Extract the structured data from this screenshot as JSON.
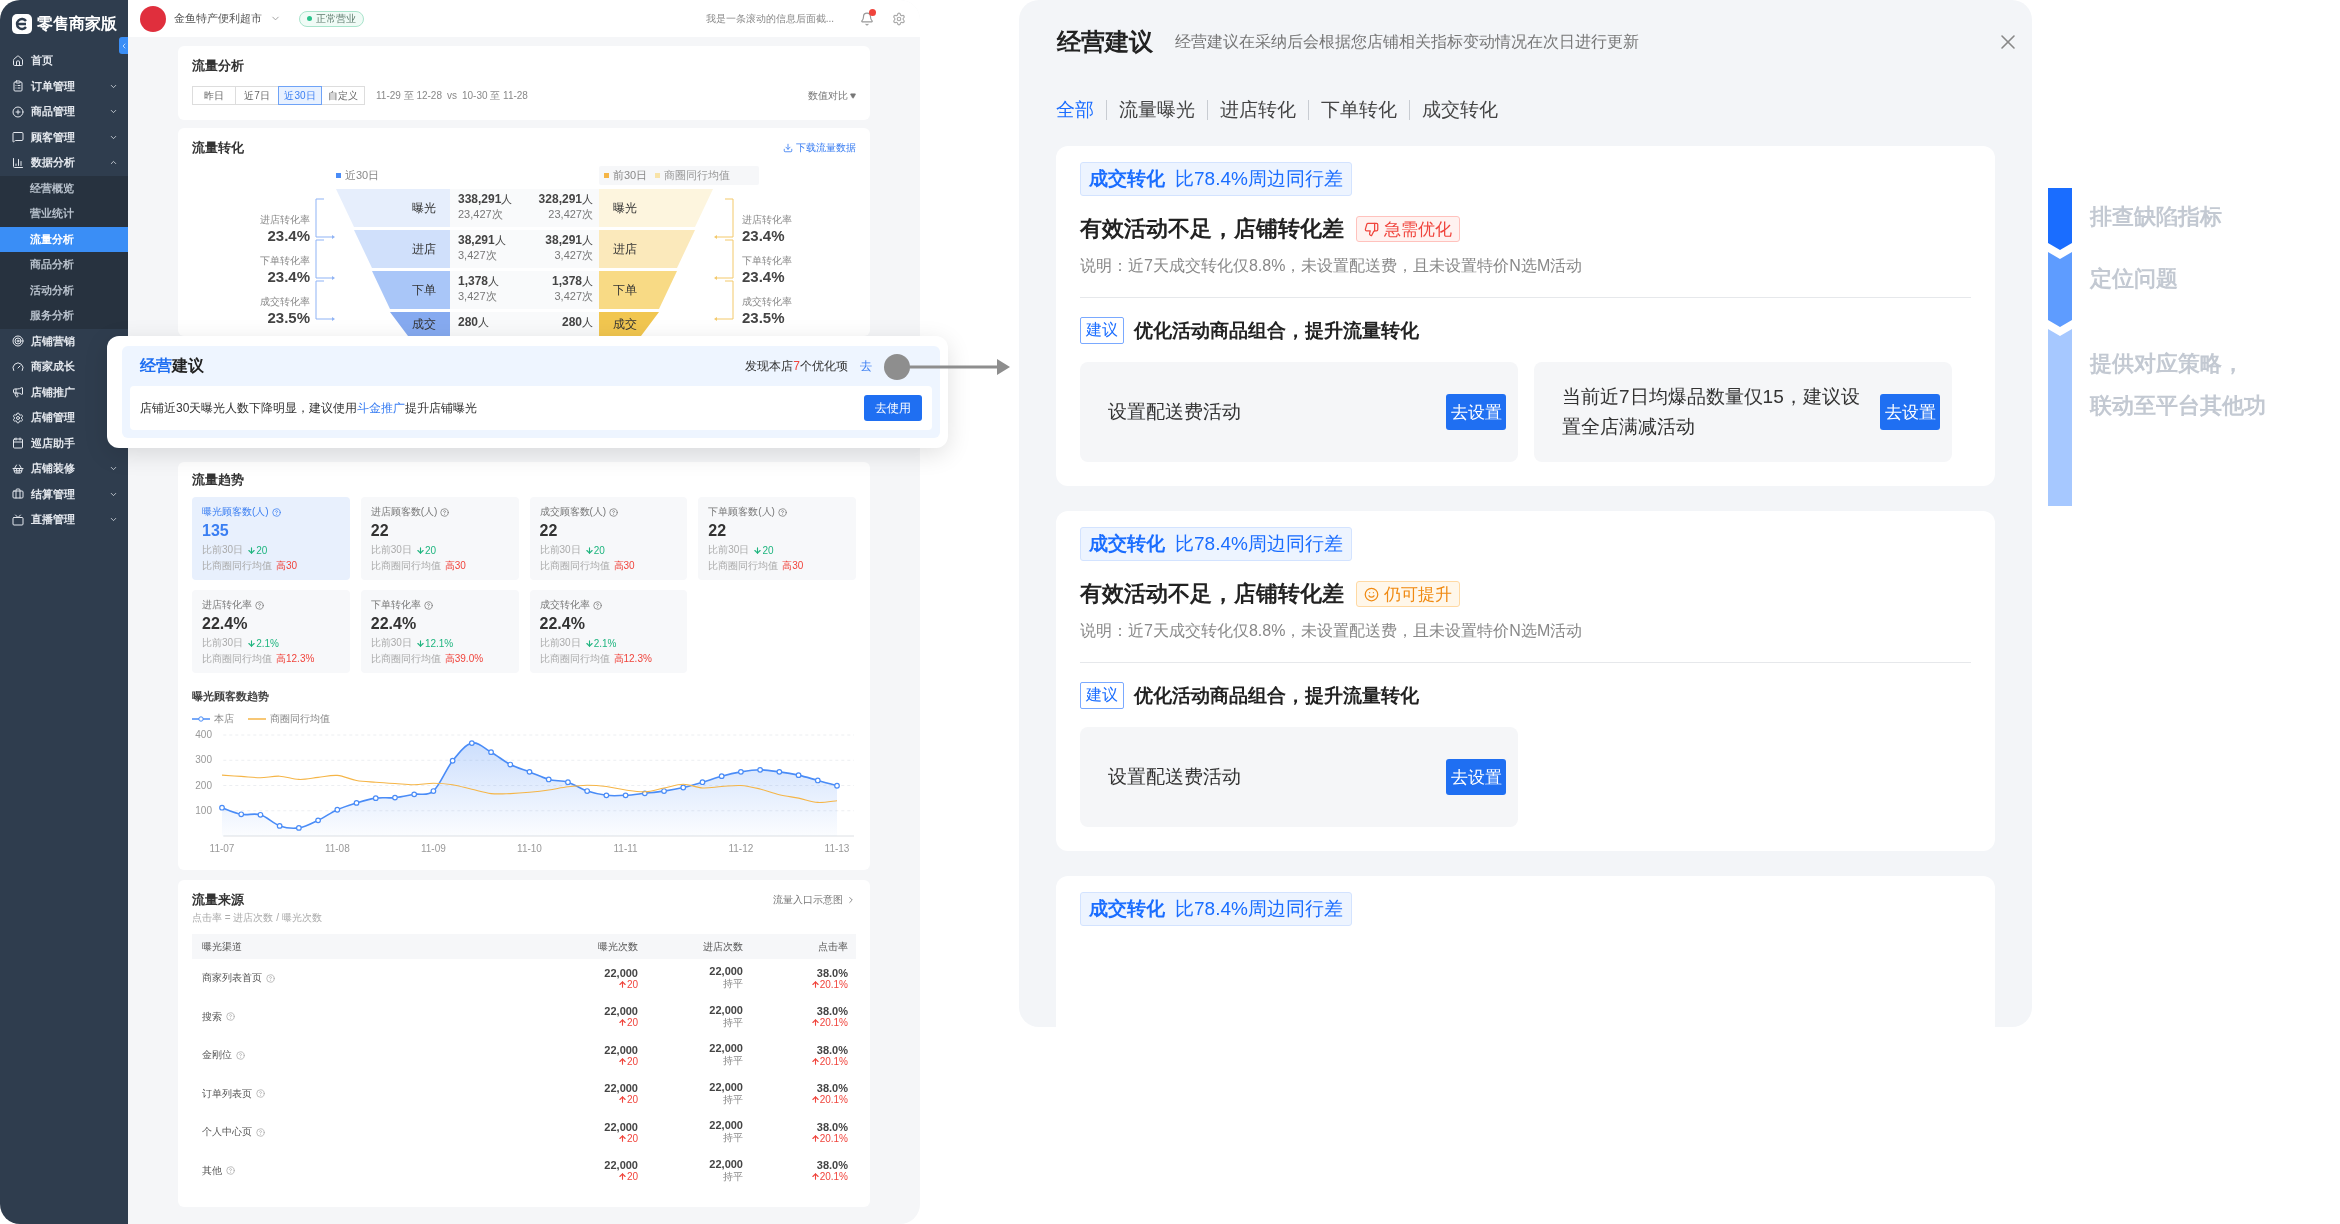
{
  "dashboard": {
    "sidebar": {
      "logo": "零售商家版",
      "items": [
        {
          "label": "首页",
          "kind": "link",
          "selected": false
        },
        {
          "label": "订单管理",
          "kind": "group",
          "expanded": false,
          "selected": false
        },
        {
          "label": "商品管理",
          "kind": "group",
          "expanded": false,
          "selected": false
        },
        {
          "label": "顾客管理",
          "kind": "group",
          "expanded": false,
          "selected": false
        },
        {
          "label": "数据分析",
          "kind": "group",
          "expanded": true,
          "selected": false,
          "children": [
            {
              "label": "经营概览",
              "selected": false
            },
            {
              "label": "营业统计",
              "selected": false
            },
            {
              "label": "流量分析",
              "selected": true
            },
            {
              "label": "商品分析",
              "selected": false
            },
            {
              "label": "活动分析",
              "selected": false
            },
            {
              "label": "服务分析",
              "selected": false
            }
          ]
        },
        {
          "label": "店铺营销",
          "kind": "link",
          "selected": false
        },
        {
          "label": "商家成长",
          "kind": "link",
          "selected": false
        },
        {
          "label": "店铺推广",
          "kind": "link",
          "selected": false
        },
        {
          "label": "店铺管理",
          "kind": "link",
          "selected": false
        },
        {
          "label": "巡店助手",
          "kind": "link",
          "selected": false
        },
        {
          "label": "店铺装修",
          "kind": "group",
          "expanded": false,
          "selected": false
        },
        {
          "label": "结算管理",
          "kind": "group",
          "expanded": false,
          "selected": false
        },
        {
          "label": "直播管理",
          "kind": "group",
          "expanded": false,
          "selected": false
        }
      ]
    },
    "header": {
      "store_name": "金鱼特产便利超市",
      "status": "正常营业",
      "ticker": "我是一条滚动的信息后面截..."
    },
    "traffic_analysis": {
      "title": "流量分析",
      "ranges": [
        {
          "label": "昨日",
          "selected": false
        },
        {
          "label": "近7日",
          "selected": false
        },
        {
          "label": "近30日",
          "selected": true
        },
        {
          "label": "自定义",
          "selected": false
        }
      ],
      "date_range": "11-29 至 12-28",
      "vs": "vs",
      "compare_range": "10-30 至 11-28",
      "compare_menu": "数值对比"
    },
    "conversion": {
      "title": "流量转化",
      "download": "下载流量数据",
      "current_legend": "近30日",
      "previous_legend": "前30日",
      "peer_legend": "商圈同行均值",
      "stages": [
        {
          "name": "曝光",
          "people": "338,291",
          "unit": "人",
          "visits": "23,427次",
          "prev_people": "328,291",
          "prev_unit": "人",
          "prev_visits": "23,427次",
          "prev_name": "曝光"
        },
        {
          "name": "进店",
          "people": "38,291",
          "unit": "人",
          "visits": "3,427次",
          "prev_people": "38,291",
          "prev_unit": "人",
          "prev_visits": "3,427次",
          "prev_name": "进店"
        },
        {
          "name": "下单",
          "people": "1,378",
          "unit": "人",
          "visits": "3,427次",
          "prev_people": "1,378",
          "prev_unit": "人",
          "prev_visits": "3,427次",
          "prev_name": "下单"
        },
        {
          "name": "成交",
          "people": "280",
          "unit": "人",
          "prev_people": "280",
          "prev_unit": "人",
          "prev_name": "成交"
        }
      ],
      "rates_current": [
        {
          "label": "进店转化率",
          "value": "23.4%"
        },
        {
          "label": "下单转化率",
          "value": "23.4%"
        },
        {
          "label": "成交转化率",
          "value": "23.5%"
        }
      ],
      "rates_previous": [
        {
          "label": "进店转化率",
          "value": "23.4%"
        },
        {
          "label": "下单转化率",
          "value": "23.4%"
        },
        {
          "label": "成交转化率",
          "value": "23.5%"
        }
      ]
    },
    "trend": {
      "title": "流量趋势",
      "metrics": [
        {
          "label": "曝光顾客数(人)",
          "value": "135",
          "prev_label": "比前30日",
          "prev_rising": false,
          "prev_change": "20",
          "peer_label": "比商圈同行均值",
          "peer_change": "高30",
          "selected": true
        },
        {
          "label": "进店顾客数(人)",
          "value": "22",
          "prev_label": "比前30日",
          "prev_rising": false,
          "prev_change": "20",
          "peer_label": "比商圈同行均值",
          "peer_change": "高30",
          "selected": false
        },
        {
          "label": "成交顾客数(人)",
          "value": "22",
          "prev_label": "比前30日",
          "prev_rising": false,
          "prev_change": "20",
          "peer_label": "比商圈同行均值",
          "peer_change": "高30",
          "selected": false
        },
        {
          "label": "下单顾客数(人)",
          "value": "22",
          "prev_label": "比前30日",
          "prev_rising": false,
          "prev_change": "20",
          "peer_label": "比商圈同行均值",
          "peer_change": "高30",
          "selected": false
        },
        {
          "label": "进店转化率",
          "value": "22.4%",
          "prev_label": "比前30日",
          "prev_rising": false,
          "prev_change": "2.1%",
          "peer_label": "比商圈同行均值",
          "peer_change": "高12.3%",
          "selected": false
        },
        {
          "label": "下单转化率",
          "value": "22.4%",
          "prev_label": "比前30日",
          "prev_rising": false,
          "prev_change": "12.1%",
          "peer_label": "比商圈同行均值",
          "peer_change": "高39.0%",
          "selected": false
        },
        {
          "label": "成交转化率",
          "value": "22.4%",
          "prev_label": "比前30日",
          "prev_rising": false,
          "prev_change": "2.1%",
          "peer_label": "比商圈同行均值",
          "peer_change": "高12.3%",
          "selected": false
        }
      ],
      "chart_data": {
        "type": "line",
        "title": "曝光顾客数趋势",
        "categories": [
          "11-07",
          null,
          null,
          null,
          null,
          null,
          "11-08",
          null,
          null,
          null,
          null,
          "11-09",
          null,
          null,
          null,
          null,
          "11-10",
          null,
          null,
          null,
          null,
          "11-11",
          null,
          null,
          null,
          null,
          null,
          "11-12",
          null,
          null,
          null,
          null,
          "11-13"
        ],
        "series": [
          {
            "name": "本店",
            "color": "#4a8cf7",
            "marker": "circle",
            "type": "area",
            "values": [
              112,
              86,
              84,
              40,
              32,
              62,
              104,
              131,
              150,
              152,
              165,
              178,
              298,
              368,
              332,
              283,
              254,
              224,
              213,
              178,
              161,
              161,
              169,
              178,
              192,
              213,
              237,
              254,
              262,
              254,
              241,
              220,
              199
            ]
          },
          {
            "name": "商圈同行均值",
            "color": "#f5b547",
            "type": "line",
            "values": [
              241,
              236,
              231,
              237,
              224,
              232,
              240,
              220,
              213,
              208,
              203,
              209,
              203,
              185,
              168,
              168,
              173,
              182,
              195,
              201,
              196,
              182,
              175,
              190,
              205,
              190,
              196,
              200,
              186,
              163,
              150,
              133,
              140
            ]
          }
        ],
        "ylim": [
          0,
          400
        ],
        "grid": true,
        "yticks": [
          100,
          200,
          300,
          400
        ]
      }
    },
    "sources": {
      "title": "流量来源",
      "formula": "点击率 = 进店次数 / 曝光次数",
      "diagram_link": "流量入口示意图",
      "columns": [
        "曝光渠道",
        "曝光次数",
        "进店次数",
        "点击率"
      ],
      "rows": [
        {
          "channel": "商家列表首页",
          "exposures": "22,000",
          "exposure_rising": true,
          "exposure_change": "20",
          "visits": "22,000",
          "visits_change": "持平",
          "ctr": "38.0%",
          "ctr_rising": true,
          "ctr_change": "20.1%"
        },
        {
          "channel": "搜索",
          "exposures": "22,000",
          "exposure_rising": true,
          "exposure_change": "20",
          "visits": "22,000",
          "visits_change": "持平",
          "ctr": "38.0%",
          "ctr_rising": true,
          "ctr_change": "20.1%"
        },
        {
          "channel": "金刚位",
          "exposures": "22,000",
          "exposure_rising": true,
          "exposure_change": "20",
          "visits": "22,000",
          "visits_change": "持平",
          "ctr": "38.0%",
          "ctr_rising": true,
          "ctr_change": "20.1%"
        },
        {
          "channel": "订单列表页",
          "exposures": "22,000",
          "exposure_rising": true,
          "exposure_change": "20",
          "visits": "22,000",
          "visits_change": "持平",
          "ctr": "38.0%",
          "ctr_rising": true,
          "ctr_change": "20.1%"
        },
        {
          "channel": "个人中心页",
          "exposures": "22,000",
          "exposure_rising": true,
          "exposure_change": "20",
          "visits": "22,000",
          "visits_change": "持平",
          "ctr": "38.0%",
          "ctr_rising": true,
          "ctr_change": "20.1%"
        },
        {
          "channel": "其他",
          "exposures": "22,000",
          "exposure_rising": true,
          "exposure_change": "20",
          "visits": "22,000",
          "visits_change": "持平",
          "ctr": "38.0%",
          "ctr_rising": true,
          "ctr_change": "20.1%"
        }
      ]
    }
  },
  "advice_popup": {
    "title_parts": [
      {
        "text": "经营",
        "accent": true
      },
      {
        "text": "建议",
        "accent": false
      }
    ],
    "summary_parts": [
      {
        "text": "发现本店",
        "accent": false
      },
      {
        "text": "7",
        "accent": true
      },
      {
        "text": "个优化项",
        "accent": false
      }
    ],
    "link": "去",
    "message_parts": [
      {
        "text": "店铺近30天曝光人数下降明显，建议使用",
        "link": false
      },
      {
        "text": "斗金推广",
        "link": true
      },
      {
        "text": "提升店铺曝光",
        "link": false
      }
    ],
    "action": "去使用"
  },
  "advice_panel": {
    "title": "经营建议",
    "subtitle": "经营建议在采纳后会根据您店铺相关指标变动情况在次日进行更新",
    "tabs": [
      {
        "label": "全部",
        "selected": true
      },
      {
        "label": "流量曝光",
        "selected": false
      },
      {
        "label": "进店转化",
        "selected": false
      },
      {
        "label": "下单转化",
        "selected": false
      },
      {
        "label": "成交转化",
        "selected": false
      }
    ],
    "cards": [
      {
        "category": "成交转化",
        "comparison": "比78.4%周边同行差",
        "issue": "有效活动不足，店铺转化差",
        "priority": {
          "label": "急需优化",
          "urgent": true
        },
        "description": "说明：近7天成交转化仅8.8%，未设置配送费，且未设置特价N选M活动",
        "advice_tag": "建议",
        "advice": "优化活动商品组合，提升流量转化",
        "actions": [
          {
            "text": "设置配送费活动",
            "button": "去设置"
          },
          {
            "text": "当前近7日均爆品数量仅15，建议设置全店满减活动",
            "button": "去设置"
          }
        ]
      },
      {
        "category": "成交转化",
        "comparison": "比78.4%周边同行差",
        "issue": "有效活动不足，店铺转化差",
        "priority": {
          "label": "仍可提升",
          "urgent": false
        },
        "description": "说明：近7天成交转化仅8.8%，未设置配送费，且未设置特价N选M活动",
        "advice_tag": "建议",
        "advice": "优化活动商品组合，提升流量转化",
        "actions": [
          {
            "text": "设置配送费活动",
            "button": "去设置"
          }
        ]
      },
      {
        "category": "成交转化",
        "comparison": "比78.4%周边同行差"
      }
    ]
  },
  "process_steps": [
    {
      "lines": [
        "排查缺陷指标"
      ]
    },
    {
      "lines": [
        "定位问题"
      ]
    },
    {
      "lines": [
        "提供对应策略，",
        "联动至平台其他功"
      ]
    }
  ]
}
